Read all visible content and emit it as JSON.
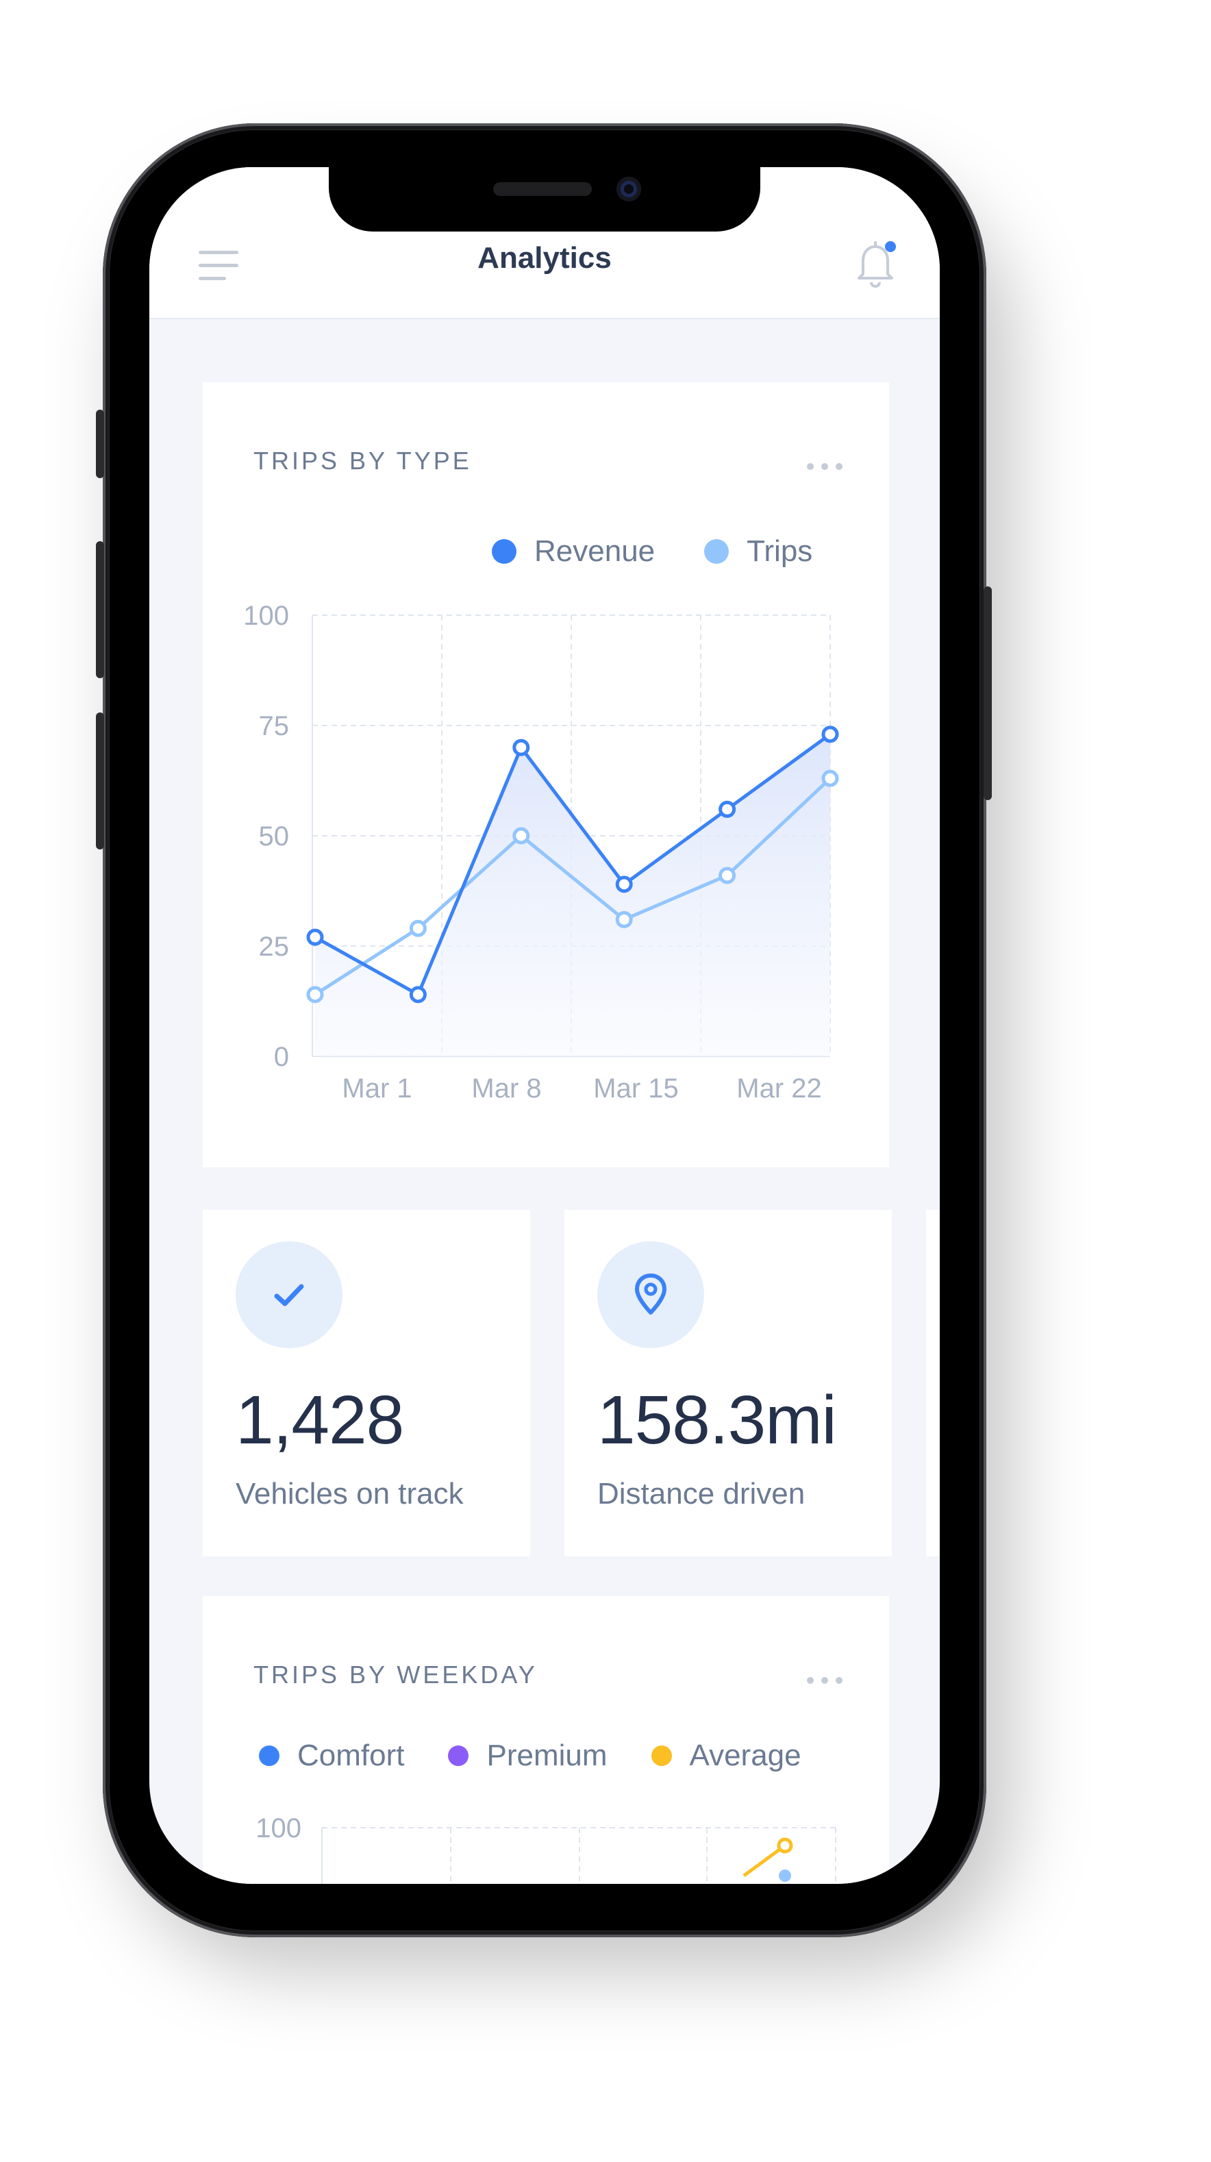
{
  "header": {
    "title": "Analytics"
  },
  "trips_by_type": {
    "title": "TRIPS BY TYPE",
    "legend": [
      {
        "label": "Revenue",
        "color": "#3b82f6"
      },
      {
        "label": "Trips",
        "color": "#93c5fd"
      }
    ]
  },
  "trips_by_weekday": {
    "title": "TRIPS BY WEEKDAY",
    "legend": [
      {
        "label": "Comfort",
        "color": "#3b82f6"
      },
      {
        "label": "Premium",
        "color": "#8b5cf6"
      },
      {
        "label": "Average",
        "color": "#fbbf24"
      }
    ],
    "y_top_label": "100"
  },
  "stats": [
    {
      "icon": "check-icon",
      "value": "1,428",
      "label": "Vehicles on track"
    },
    {
      "icon": "map-pin-icon",
      "value": "158.3mi",
      "label": "Distance driven"
    }
  ],
  "chart_data": [
    {
      "type": "line",
      "title": "TRIPS BY TYPE",
      "x": [
        "",
        "Mar 1",
        "Mar 8",
        "Mar 15",
        "",
        "Mar 22"
      ],
      "x_tick_labels": [
        "Mar 1",
        "Mar 8",
        "Mar 15",
        "Mar 22"
      ],
      "y_ticks": [
        0,
        25,
        50,
        75,
        100
      ],
      "ylim": [
        0,
        100
      ],
      "grid": true,
      "legend_position": "top-right",
      "series": [
        {
          "name": "Revenue",
          "color": "#3b82f6",
          "values": [
            27,
            14,
            70,
            39,
            56,
            73
          ]
        },
        {
          "name": "Trips",
          "color": "#93c5fd",
          "values": [
            14,
            29,
            50,
            31,
            41,
            63
          ]
        }
      ]
    }
  ]
}
